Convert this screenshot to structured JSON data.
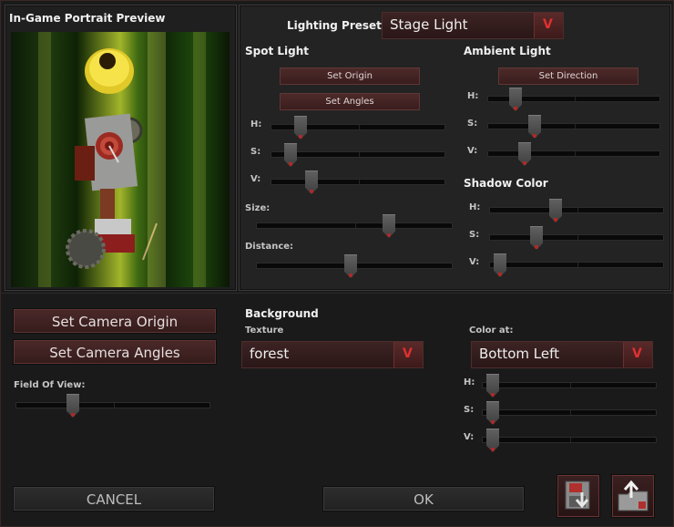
{
  "preview": {
    "title": "In-Game Portrait Preview"
  },
  "lighting": {
    "preset_label": "Lighting Preset:",
    "preset_value": "Stage Light"
  },
  "spot_light": {
    "title": "Spot Light",
    "set_origin": "Set Origin",
    "set_angles": "Set Angles",
    "h_label": "H:",
    "s_label": "S:",
    "v_label": "V:",
    "size_label": "Size:",
    "distance_label": "Distance:",
    "h": 0.14,
    "s": 0.08,
    "v": 0.21,
    "size": 0.69,
    "distance": 0.48
  },
  "ambient_light": {
    "title": "Ambient Light",
    "set_direction": "Set Direction",
    "h_label": "H:",
    "s_label": "S:",
    "v_label": "V:",
    "h": 0.13,
    "s": 0.25,
    "v": 0.19
  },
  "shadow_color": {
    "title": "Shadow Color",
    "h_label": "H:",
    "s_label": "S:",
    "v_label": "V:",
    "h": 0.37,
    "s": 0.25,
    "v": 0.02
  },
  "camera": {
    "set_origin": "Set Camera Origin",
    "set_angles": "Set Camera Angles",
    "fov_label": "Field Of View:",
    "fov": 0.28
  },
  "background": {
    "title": "Background",
    "texture_label": "Texture",
    "texture_value": "forest",
    "color_at_label": "Color at:",
    "color_at_value": "Bottom Left",
    "h_label": "H:",
    "s_label": "S:",
    "v_label": "V:",
    "h": 0.02,
    "s": 0.02,
    "v": 0.02
  },
  "footer": {
    "cancel": "CANCEL",
    "ok": "OK"
  },
  "icons": {
    "save": "save-icon",
    "load": "load-folder-icon",
    "dropdown": "chevron-down-icon"
  },
  "colors": {
    "accent": "#e03030",
    "button_bg": "#4a2828",
    "panel_bg": "#232323"
  }
}
